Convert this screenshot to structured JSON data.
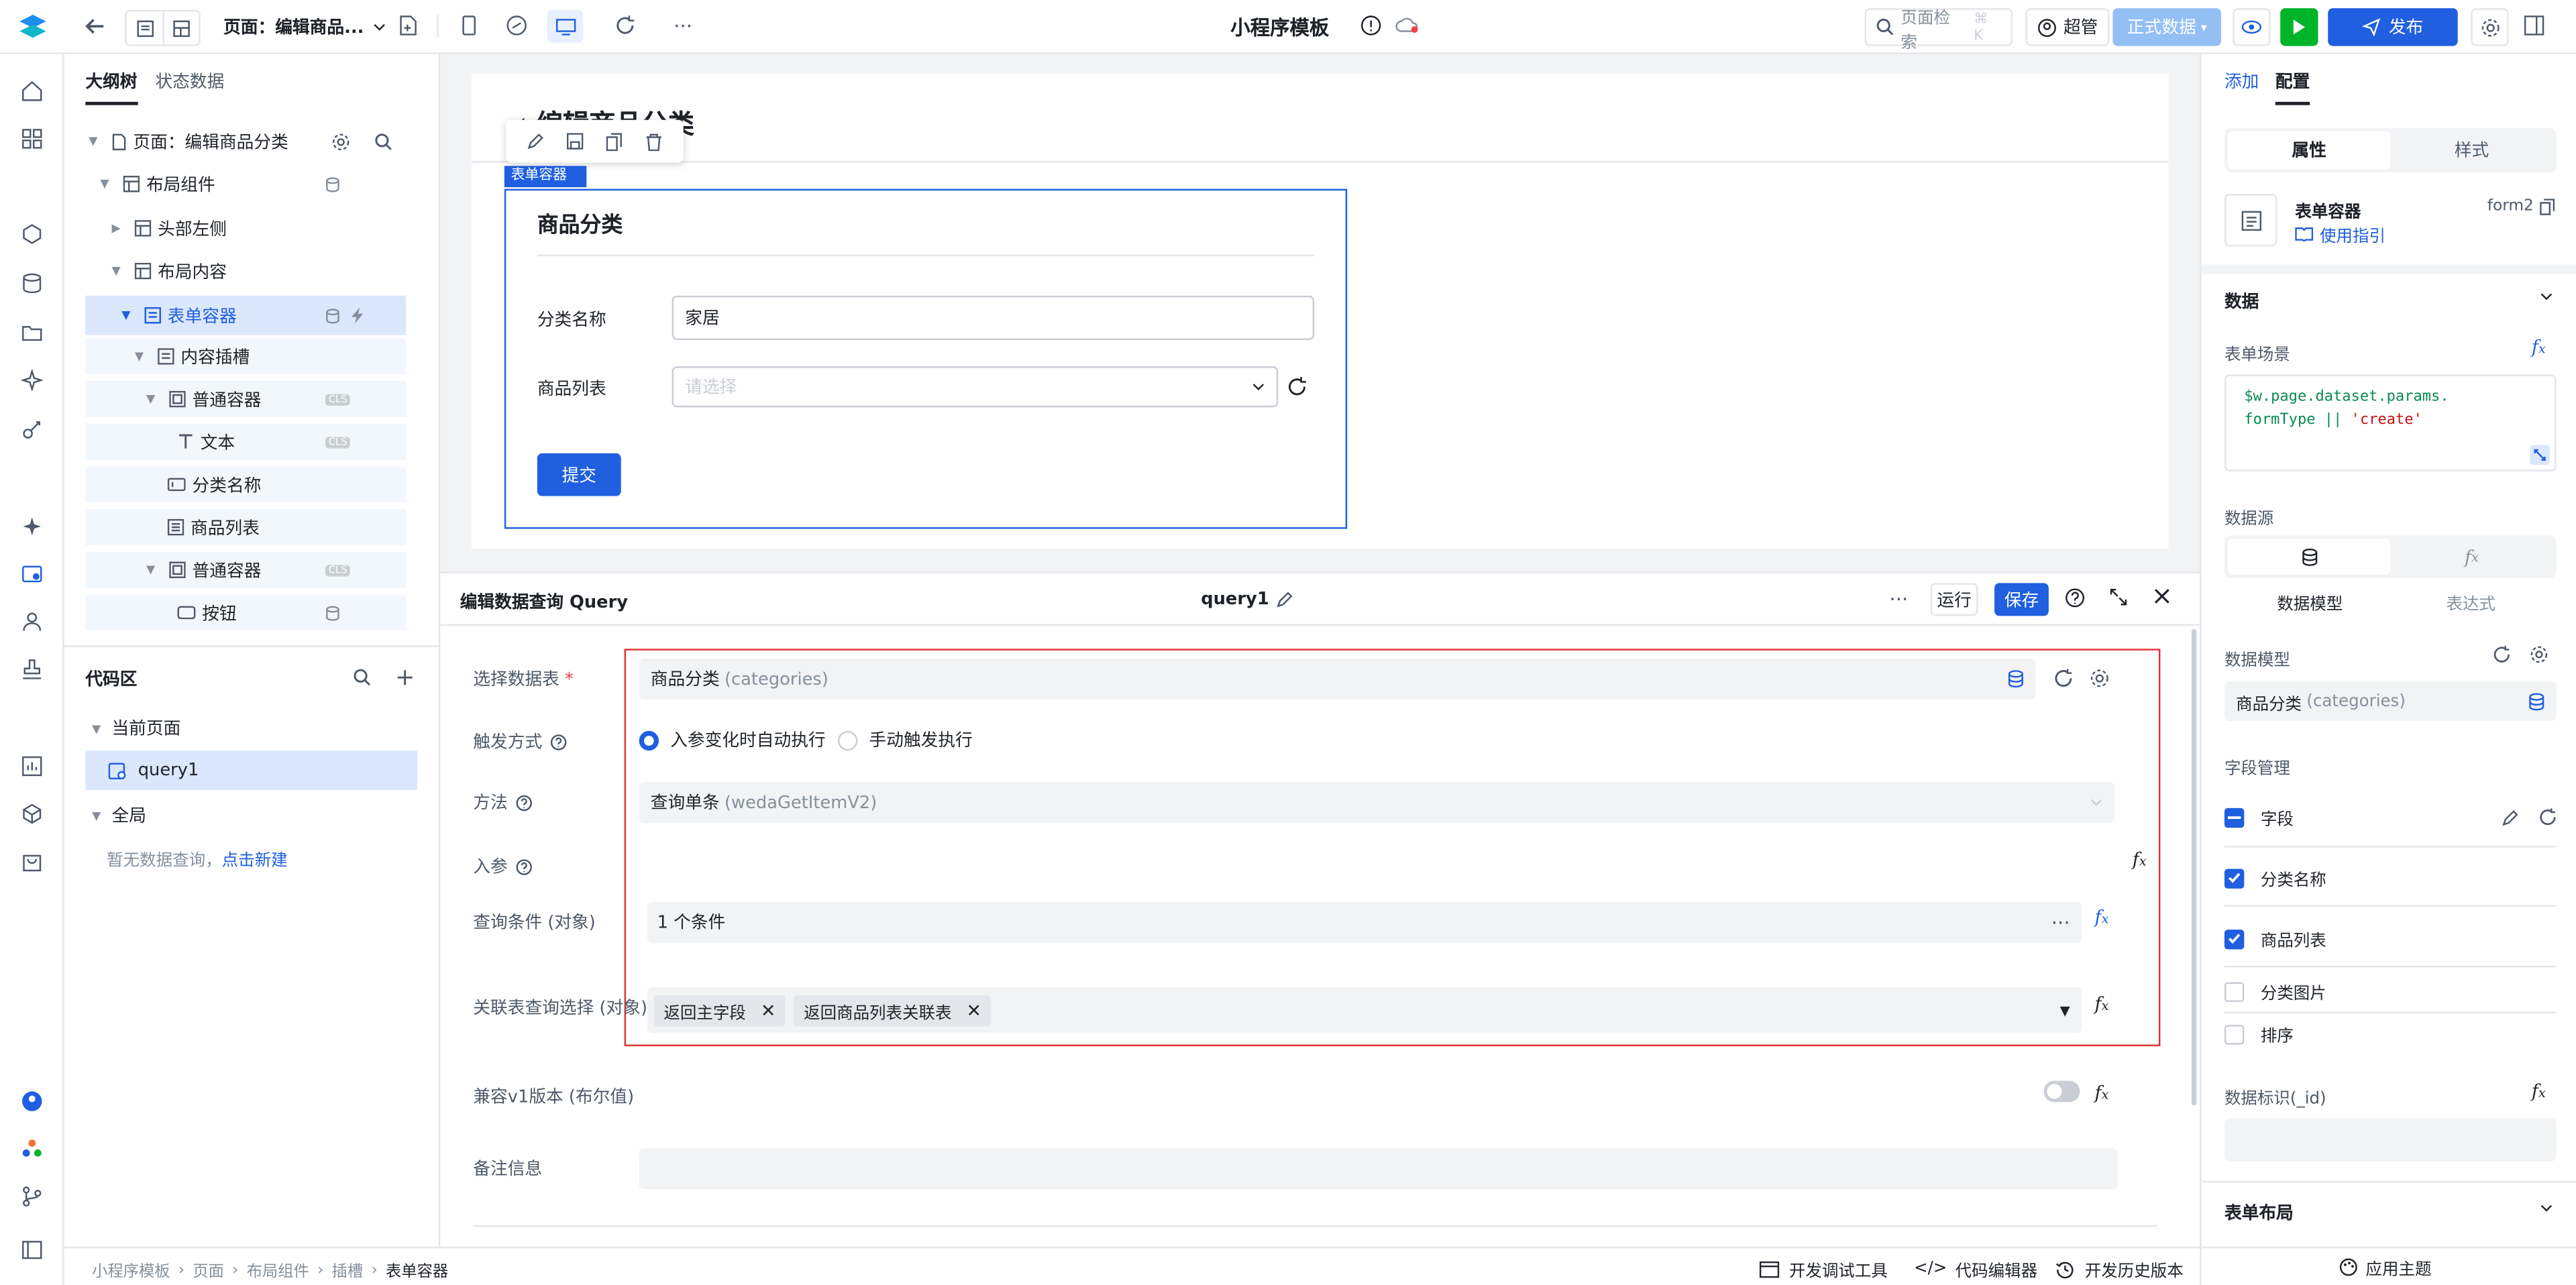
{
  "topbar": {
    "page_label": "页面：编辑商品...",
    "app_title": "小程序模板",
    "search_placeholder": "页面检索",
    "search_shortcut": "⌘ K",
    "user": "超管",
    "env": "正式数据",
    "publish": "发布"
  },
  "left_tabs": [
    "大纲树",
    "状态数据"
  ],
  "tree": [
    {
      "label": "页面：编辑商品分类"
    },
    {
      "label": "布局组件"
    },
    {
      "label": "头部左侧"
    },
    {
      "label": "布局内容"
    },
    {
      "label": "表单容器"
    },
    {
      "label": "内容插槽"
    },
    {
      "label": "普通容器"
    },
    {
      "label": "文本"
    },
    {
      "label": "分类名称"
    },
    {
      "label": "商品列表"
    },
    {
      "label": "普通容器"
    },
    {
      "label": "按钮"
    }
  ],
  "cls_tag": "CLS",
  "code_area": {
    "title": "代码区",
    "current_page": "当前页面",
    "query_item": "query1",
    "global": "全局",
    "empty_text": "暂无数据查询，",
    "create_link": "点击新建"
  },
  "canvas": {
    "page_heading": "编辑商品分类",
    "container_tag": "表单容器",
    "form_title": "商品分类",
    "field1_label": "分类名称",
    "field1_value": "家居",
    "field2_label": "商品列表",
    "field2_placeholder": "请选择",
    "submit": "提交"
  },
  "query": {
    "title": "编辑数据查询 Query",
    "name": "query1",
    "run": "运行",
    "save": "保存",
    "table_label": "选择数据表",
    "table_value": "商品分类",
    "table_sub": "(categories)",
    "trigger_label": "触发方式",
    "trigger_auto": "入参变化时自动执行",
    "trigger_manual": "手动触发执行",
    "method_label": "方法",
    "method_value": "查询单条",
    "method_sub": "(wedaGetItemV2)",
    "params_label": "入参",
    "cond_label": "查询条件 (对象)",
    "cond_value": "1 个条件",
    "rel_label": "关联表查询选择 (对象)",
    "rel_tags": [
      "返回主字段",
      "返回商品列表关联表"
    ],
    "compat_label": "兼容v1版本 (布尔值)",
    "remark_label": "备注信息"
  },
  "right": {
    "tabs": [
      "添加",
      "配置"
    ],
    "seg": [
      "属性",
      "样式"
    ],
    "comp_name": "表单容器",
    "comp_id": "form2",
    "guide": "使用指引",
    "data_section": "数据",
    "scene_label": "表单场景",
    "code_line1": "$w.page.dataset.params.",
    "code_line2a": "formType || ",
    "code_line2b": "'create'",
    "source_label": "数据源",
    "source_opts": [
      "数据模型",
      "表达式"
    ],
    "model_label": "数据模型",
    "model_value": "商品分类",
    "model_sub": "(categories)",
    "field_mgmt": "字段管理",
    "fields": [
      {
        "label": "字段",
        "state": "partial"
      },
      {
        "label": "分类名称",
        "state": "checked"
      },
      {
        "label": "商品列表",
        "state": "checked"
      },
      {
        "label": "分类图片",
        "state": "unchecked"
      },
      {
        "label": "排序",
        "state": "unchecked"
      }
    ],
    "id_label": "数据标识(_id)",
    "layout_section": "表单布局",
    "theme": "应用主题"
  },
  "breadcrumb": [
    "小程序模板",
    "页面",
    "布局组件",
    "插槽",
    "表单容器"
  ],
  "status_tools": [
    "开发调试工具",
    "代码编辑器",
    "开发历史版本"
  ],
  "colors": {
    "accent": "#1f5fe0",
    "green": "#00b42a",
    "red_outline": "#e03131"
  }
}
